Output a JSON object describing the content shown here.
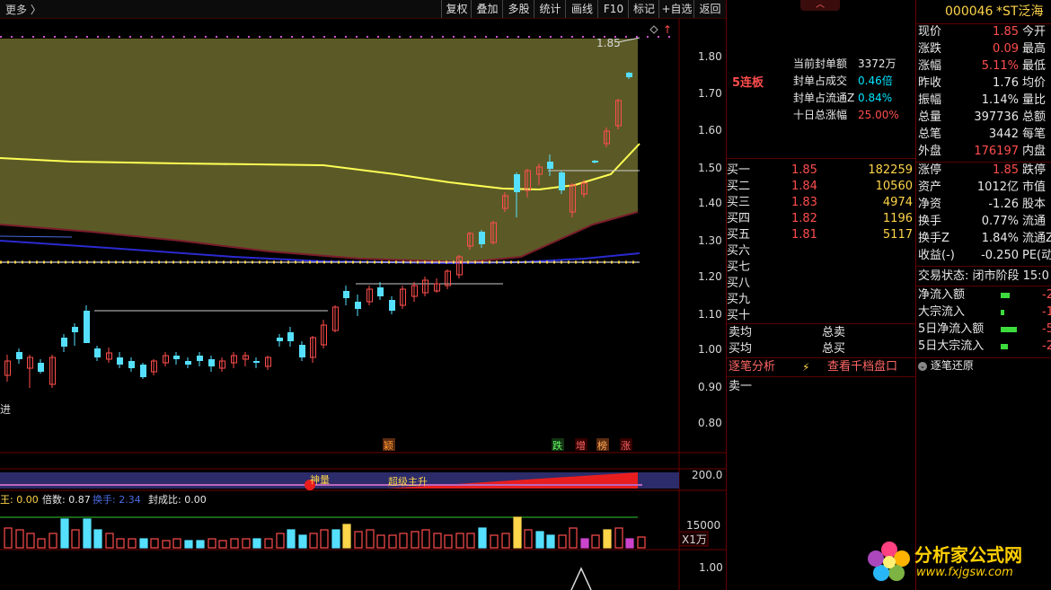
{
  "toolbar": {
    "more": "更多 〉",
    "buttons": [
      "复权",
      "叠加",
      "多股",
      "统计",
      "画线",
      "F10",
      "标记",
      "+自选",
      "返回"
    ]
  },
  "chart": {
    "price_axis": [
      "1.80",
      "1.70",
      "1.60",
      "1.50",
      "1.40",
      "1.30",
      "1.20",
      "1.10",
      "1.00",
      "0.90",
      "0.80"
    ],
    "ind_axis": "200.0",
    "vol_axis": "15000",
    "vol_unit": "X1万",
    "bottom_axis": "1.00",
    "last_price_label": "1.85",
    "left_label": "进",
    "signals": [
      "颖",
      "跌",
      "增",
      "榜",
      "涨"
    ],
    "ind_label_1": "神量",
    "ind_label_2": "超级主升",
    "formula_line": {
      "a": "王: 0.00",
      "b": "倍数: 0.87",
      "c": "换手: 2.34",
      "d": "封成比: 0.00"
    },
    "colors": {
      "up": "#ff4d4d",
      "down": "#55e0ff",
      "ma_yellow": "#ffff55",
      "band": "#5b5a26"
    }
  },
  "mid": {
    "board_count": "5连板",
    "stats": [
      {
        "label": "当前封单额",
        "value": "3372万",
        "color": "#e8e8e8"
      },
      {
        "label": "封单占成交",
        "value": "0.46倍",
        "color": "#00e5ff"
      },
      {
        "label": "封单占流通Z",
        "value": "0.84%",
        "color": "#00e5ff"
      },
      {
        "label": "十日总涨幅",
        "value": "25.00%",
        "color": "#ff4d4d"
      }
    ],
    "bids": [
      {
        "label": "买一",
        "price": "1.85",
        "vol": "182259"
      },
      {
        "label": "买二",
        "price": "1.84",
        "vol": "10560"
      },
      {
        "label": "买三",
        "price": "1.83",
        "vol": "4974"
      },
      {
        "label": "买四",
        "price": "1.82",
        "vol": "1196"
      },
      {
        "label": "买五",
        "price": "1.81",
        "vol": "5117"
      },
      {
        "label": "买六",
        "price": "",
        "vol": ""
      },
      {
        "label": "买七",
        "price": "",
        "vol": ""
      },
      {
        "label": "买八",
        "price": "",
        "vol": ""
      },
      {
        "label": "买九",
        "price": "",
        "vol": ""
      },
      {
        "label": "买十",
        "price": "",
        "vol": ""
      }
    ],
    "sell_avg": "卖均",
    "buy_avg": "买均",
    "total_sell": "总卖",
    "total_buy": "总买",
    "tick_analysis": "逐笔分析",
    "view_depth": "查看千档盘口",
    "sell_one": "卖一"
  },
  "right": {
    "code": "000046",
    "name": "*ST泛海",
    "quote": [
      {
        "l": "现价",
        "v": "1.85",
        "vc": "red",
        "r": "今开"
      },
      {
        "l": "涨跌",
        "v": "0.09",
        "vc": "red",
        "r": "最高"
      },
      {
        "l": "涨幅",
        "v": "5.11%",
        "vc": "red",
        "r": "最低"
      },
      {
        "l": "昨收",
        "v": "1.76",
        "vc": "wht",
        "r": "均价"
      },
      {
        "l": "振幅",
        "v": "1.14%",
        "vc": "wht",
        "r": "量比"
      },
      {
        "l": "总量",
        "v": "397736",
        "vc": "wht",
        "r": "总额"
      },
      {
        "l": "总笔",
        "v": "3442",
        "vc": "wht",
        "r": "每笔"
      },
      {
        "l": "外盘",
        "v": "176197",
        "vc": "red",
        "r": "内盘"
      }
    ],
    "fund": [
      {
        "l": "涨停",
        "v": "1.85",
        "vc": "red",
        "r": "跌停"
      },
      {
        "l": "资产",
        "v": "1012亿",
        "vc": "wht",
        "r": "市值"
      },
      {
        "l": "净资",
        "v": "-1.26",
        "vc": "wht",
        "r": "股本"
      },
      {
        "l": "换手",
        "v": "0.77%",
        "vc": "wht",
        "r": "流通"
      },
      {
        "l": "换手Z",
        "v": "1.84%",
        "vc": "wht",
        "r": "流通Z"
      },
      {
        "l": "收益(-)",
        "v": "-0.250",
        "vc": "wht",
        "r": "PE(动"
      }
    ],
    "trade_status": "交易状态: 闭市阶段 15:0",
    "flows": [
      {
        "l": "净流入额",
        "v": "-2"
      },
      {
        "l": "大宗流入",
        "v": "-1"
      },
      {
        "l": "5日净流入额",
        "v": "-5"
      },
      {
        "l": "5日大宗流入",
        "v": "-2"
      }
    ],
    "tick_restore": "逐笔还原",
    "watermark_title": "分析家公式网",
    "watermark_url": "www.fxjgsw.com"
  }
}
